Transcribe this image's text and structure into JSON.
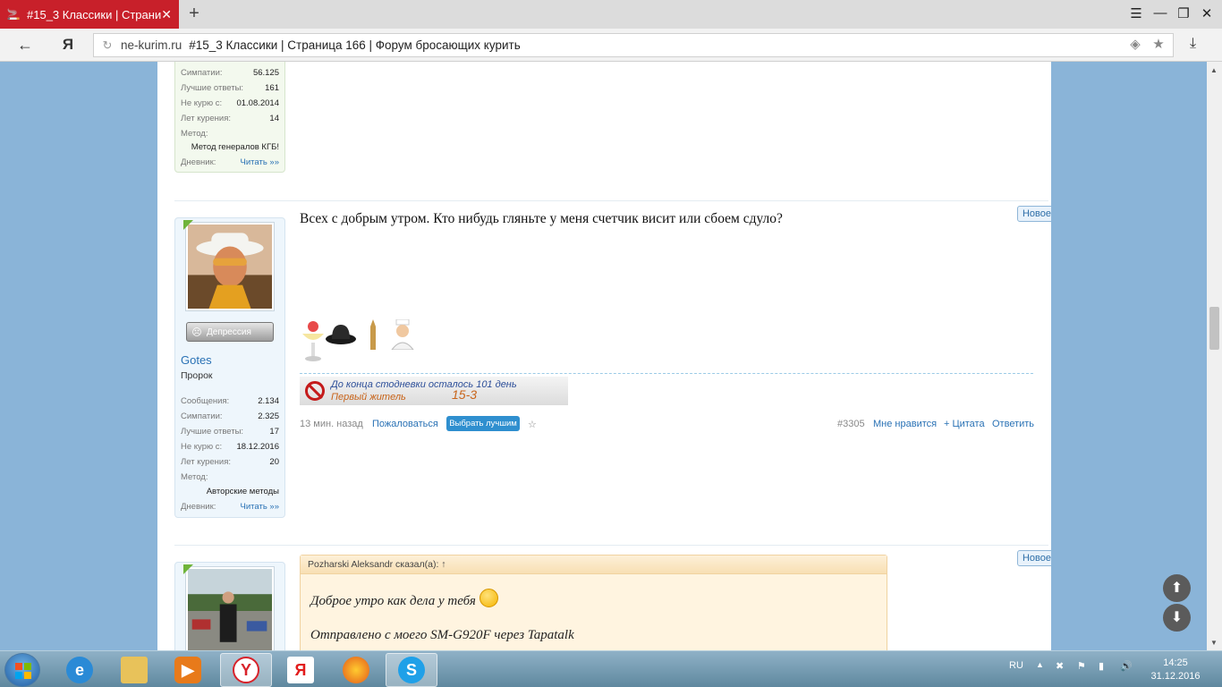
{
  "browser": {
    "tab_title": "#15_3 Классики | Страница 166 | Форум бросающих курить",
    "tab_title_visible": "#15_3 Классики | Страни",
    "new_tab": "+",
    "close_tab": "✕",
    "back": "←",
    "yandex_logo": "Я",
    "reload": "↻",
    "domain": "ne-kurim.ru",
    "page_title": "#15_3 Классики | Страница 166 | Форум бросающих курить",
    "menu": "☰",
    "minimize": "—",
    "restore": "❐",
    "close": "✕",
    "download": "⤓",
    "star": "★",
    "protect": "◈"
  },
  "user1": {
    "stats": [
      {
        "label": "Симпатии:",
        "value": "56.125"
      },
      {
        "label": "Лучшие ответы:",
        "value": "161"
      },
      {
        "label": "Не курю с:",
        "value": "01.08.2014"
      },
      {
        "label": "Лет курения:",
        "value": "14"
      }
    ],
    "method_label": "Метод:",
    "method_value": "Метод генералов КГБ!",
    "diary_label": "Дневник:",
    "diary_link": "Читать »»"
  },
  "post1": {
    "new_badge": "Новое",
    "message": "Всех с добрым утром. Кто нибудь гляньте у меня счетчик висит или сбоем сдуло?",
    "user": {
      "mood": "Депрессия",
      "name": "Gotes",
      "title": "Пророк",
      "stats": [
        {
          "label": "Сообщения:",
          "value": "2.134"
        },
        {
          "label": "Симпатии:",
          "value": "2.325"
        },
        {
          "label": "Лучшие ответы:",
          "value": "17"
        },
        {
          "label": "Не курю с:",
          "value": "18.12.2016"
        },
        {
          "label": "Лет курения:",
          "value": "20"
        }
      ],
      "method_label": "Метод:",
      "method_value": "Авторские методы",
      "diary_label": "Дневник:",
      "diary_link": "Читать »»"
    },
    "signature": {
      "line1": "До конца стодневки осталось 101 день",
      "line2": "Первый житель",
      "tag": "15-3"
    },
    "footer": {
      "time": "13 мин. назад",
      "report": "Пожаловаться",
      "best_answer": "Выбрать лучшим",
      "star": "☆",
      "post_number": "#3305",
      "like": "Мне нравится",
      "quote": "+ Цитата",
      "reply": "Ответить"
    }
  },
  "post2": {
    "new_badge": "Новое",
    "quote_header": "Pozharski Aleksandr сказал(а): ↑",
    "quote_line1": "Доброе утро как дела у тебя",
    "quote_line2": "Отправлено с моего SM-G920F через Tapatalk"
  },
  "page_controls": {
    "up": "⬆",
    "down": "⬇"
  },
  "taskbar": {
    "lang": "RU",
    "time": "14:25",
    "date": "31.12.2016"
  },
  "colors": {
    "tab_red": "#c8202a",
    "link_blue": "#2a72b5",
    "green_corner": "#6fb43a",
    "best_button": "#2f8fcf"
  }
}
